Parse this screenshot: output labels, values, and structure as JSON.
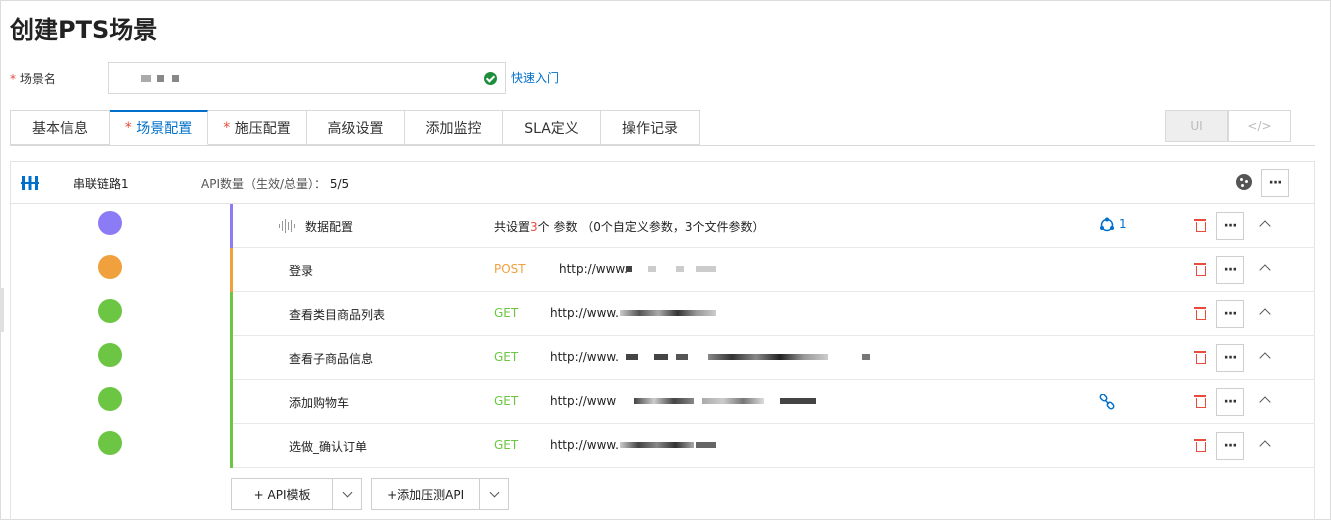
{
  "page": {
    "title": "创建PTS场景"
  },
  "form": {
    "required_mark": "*",
    "scene_name_label": "场景名",
    "quick_start": "快速入门"
  },
  "tabs": [
    {
      "label": "基本信息",
      "required": false,
      "active": false
    },
    {
      "label": "场景配置",
      "required": true,
      "active": true
    },
    {
      "label": "施压配置",
      "required": true,
      "active": false
    },
    {
      "label": "高级设置",
      "required": false,
      "active": false
    },
    {
      "label": "添加监控",
      "required": false,
      "active": false
    },
    {
      "label": "SLA定义",
      "required": false,
      "active": false
    },
    {
      "label": "操作记录",
      "required": false,
      "active": false
    }
  ],
  "view_toggle": {
    "ui": "UI",
    "code": "</>"
  },
  "chain": {
    "title": "串联链路1",
    "api_count_label": "API数量（生效/总量）：",
    "api_count_value": "5/5"
  },
  "data_config": {
    "name": "数据配置",
    "summary_prefix": "共设置",
    "summary_count": "3",
    "summary_suffix": "个 参数 （0个自定义参数，3个文件参数）",
    "badge_count": "1"
  },
  "apis": [
    {
      "name": "登录",
      "method": "POST",
      "url": "http://www."
    },
    {
      "name": "查看类目商品列表",
      "method": "GET",
      "url": "http://www."
    },
    {
      "name": "查看子商品信息",
      "method": "GET",
      "url": "http://www."
    },
    {
      "name": "添加购物车",
      "method": "GET",
      "url": "http://www"
    },
    {
      "name": "选做_确认订单",
      "method": "GET",
      "url": "http://www."
    }
  ],
  "footer": {
    "api_template": "+ API模板",
    "add_api": "+添加压测API"
  },
  "colors": {
    "accent": "#0070cc",
    "data_bar": "#8b7cf6",
    "post": "#f0a03c",
    "get": "#6cc644",
    "danger": "#e64b3c"
  }
}
